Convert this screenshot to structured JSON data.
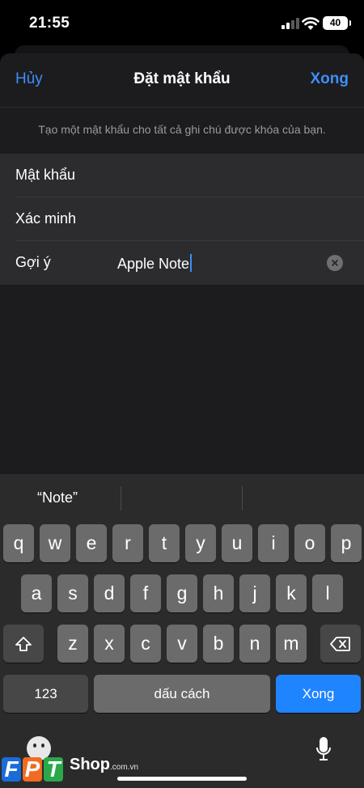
{
  "status": {
    "time": "21:55",
    "battery": "40"
  },
  "nav": {
    "cancel": "Hủy",
    "title": "Đặt mật khẩu",
    "done": "Xong"
  },
  "description": "Tạo một mật khẩu cho tất cả ghi chú được khóa của bạn.",
  "form": {
    "password_label": "Mật khẩu",
    "password_value": "",
    "verify_label": "Xác minh",
    "verify_value": "",
    "hint_label": "Gợi ý",
    "hint_value": "Apple Note"
  },
  "keyboard": {
    "suggestions": [
      "“Note”",
      "",
      ""
    ],
    "row1": [
      "q",
      "w",
      "e",
      "r",
      "t",
      "y",
      "u",
      "i",
      "o",
      "p"
    ],
    "row2": [
      "a",
      "s",
      "d",
      "f",
      "g",
      "h",
      "j",
      "k",
      "l"
    ],
    "row3": [
      "z",
      "x",
      "c",
      "v",
      "b",
      "n",
      "m"
    ],
    "numbers_key": "123",
    "space_key": "dấu cách",
    "return_key": "Xong",
    "return_color": "#1f84ff"
  },
  "watermark": {
    "letters": [
      "F",
      "P",
      "T"
    ],
    "shop": "Shop",
    "domain": ".com.vn"
  },
  "colors": {
    "accent": "#3e8ef7",
    "sheet": "#1c1c1e",
    "keyboard": "#2b2b2b"
  }
}
